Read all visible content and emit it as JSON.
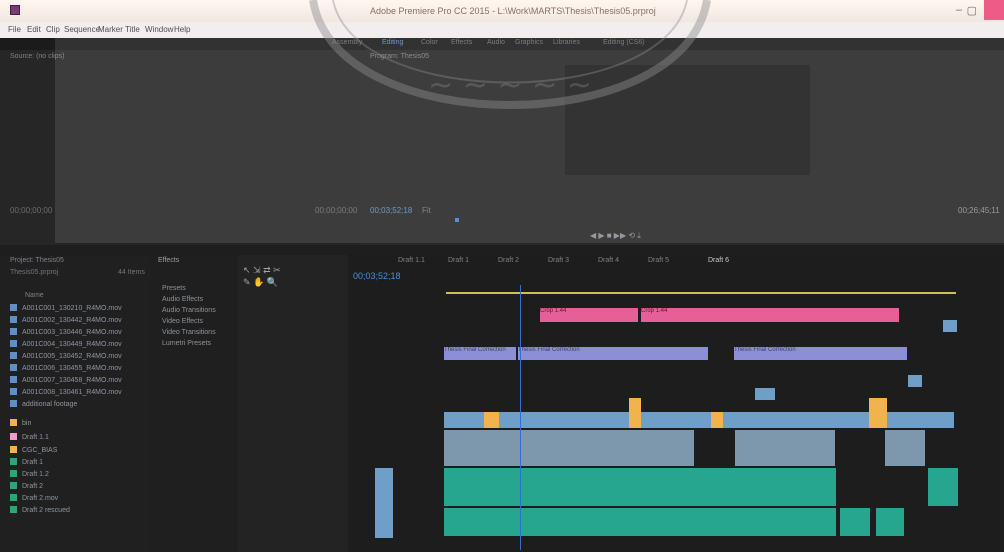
{
  "window": {
    "title": "Adobe Premiere Pro CC 2015 - L:\\Work\\MARTS\\Thesis\\Thesis05.prproj"
  },
  "menu": [
    "File",
    "Edit",
    "Clip",
    "Sequence",
    "Marker",
    "Title",
    "Window",
    "Help"
  ],
  "workspaces": [
    "Assembly",
    "Editing",
    "Color",
    "Effects",
    "Audio",
    "Graphics",
    "Libraries",
    "Editing (CS6)"
  ],
  "source": {
    "tab": "Source: (no clips)",
    "timecode_in": "00;00;00;00",
    "timecode_out": "00;00;00;00"
  },
  "program": {
    "tab": "Program: Thesis05",
    "timecode": "00;03;52;18",
    "duration": "00;26;45;11",
    "fit": "Fit"
  },
  "project": {
    "tab": "Project: Thesis05",
    "search_placeholder": "Thesis05.prproj",
    "count": "44 Items",
    "column": "Name",
    "items": [
      "A001C001_130210_R4MO.mov",
      "A001C002_130442_R4MO.mov",
      "A001C003_130446_R4MO.mov",
      "A001C004_130449_R4MO.mov",
      "A001C005_130452_R4MO.mov",
      "A001C006_130455_R4MO.mov",
      "A001C007_130458_R4MO.mov",
      "A001C008_130461_R4MO.mov",
      "additional footage",
      "bin",
      "Draft 1.1",
      "CGC_BIAS",
      "Draft 1",
      "Draft 1.2",
      "Draft 2",
      "Draft 2.mov",
      "Draft 2 rescued"
    ]
  },
  "effects": {
    "tab": "Effects",
    "items": [
      "Presets",
      "Audio Effects",
      "Audio Transitions",
      "Video Effects",
      "Video Transitions",
      "Lumetri Presets"
    ]
  },
  "timeline": {
    "timecode": "00;03;52;18",
    "tabs": [
      "Draft 1.1",
      "Draft 1",
      "Draft 2",
      "Draft 3",
      "Draft 4",
      "Draft 5",
      "Draft 6"
    ],
    "clips": {
      "pink": [
        "Crop 1.44",
        "Crop 1.44"
      ],
      "purple": [
        "Thesis Final Correction",
        "Thesis Final Correction",
        "Thesis Final Correction"
      ]
    }
  },
  "colors": {
    "pink": "#e65f97",
    "purple": "#8b8fd8",
    "teal": "#26a68e",
    "orange": "#f2b34d",
    "blue": "#6f9ec9"
  }
}
